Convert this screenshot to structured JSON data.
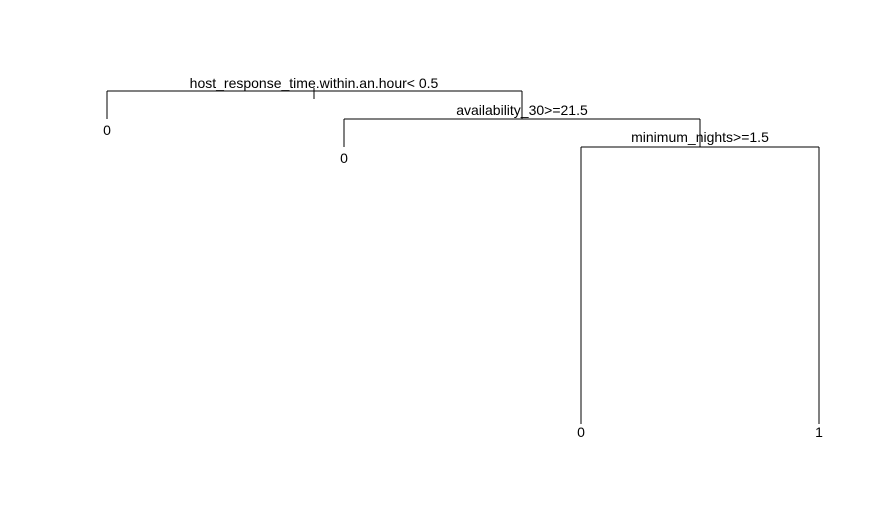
{
  "tree": {
    "splits": [
      {
        "label": "host_response_time.within.an.hour< 0.5"
      },
      {
        "label": "availability_30>=21.5"
      },
      {
        "label": "minimum_nights>=1.5"
      }
    ],
    "leaves": [
      {
        "label": "0"
      },
      {
        "label": "0"
      },
      {
        "label": "0"
      },
      {
        "label": "1"
      }
    ]
  }
}
